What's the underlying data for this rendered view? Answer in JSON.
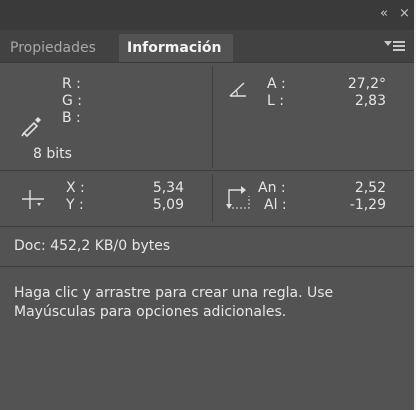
{
  "header": {
    "collapse_glyph": "«",
    "close_glyph": "×"
  },
  "tabs": [
    {
      "label": "Propiedades",
      "active": false
    },
    {
      "label": "Información",
      "active": true
    }
  ],
  "color_readout": {
    "r_label": "R :",
    "g_label": "G :",
    "b_label": "B :",
    "bit_depth": "8 bits",
    "icon": "eyedropper-icon"
  },
  "angle_readout": {
    "a_label": "A :",
    "a_value": "27,2°",
    "l_label": "L :",
    "l_value": "2,83",
    "icon": "angle-icon"
  },
  "position_readout": {
    "x_label": "X :",
    "x_value": "5,34",
    "y_label": "Y :",
    "y_value": "5,09",
    "icon": "crosshair-icon"
  },
  "size_readout": {
    "w_label": "An :",
    "w_value": "2,52",
    "h_label": "Al :",
    "h_value": "-1,29",
    "icon": "selection-size-icon"
  },
  "doc_info": "Doc: 452,2 KB/0 bytes",
  "hint": "Haga clic y arrastre para crear una regla. Use Mayúsculas para opciones adicionales.",
  "colors": {
    "panel_bg": "#535353",
    "titlebar_bg": "#3a3a3a",
    "tabbar_bg": "#424242",
    "text": "#e6e6e6"
  }
}
